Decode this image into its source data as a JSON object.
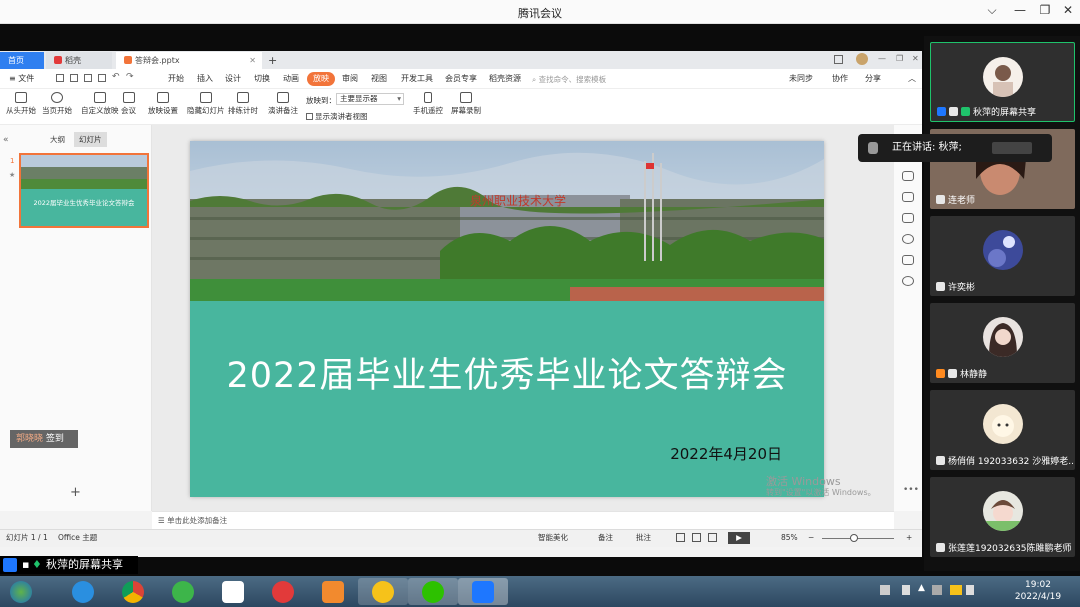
{
  "window": {
    "title": "腾讯会议",
    "controls": [
      "⌵",
      "—",
      "❐",
      "✕"
    ]
  },
  "wps": {
    "tabs": [
      {
        "label": "首页"
      },
      {
        "label": "稻壳"
      },
      {
        "label": "答辩会.pptx"
      }
    ],
    "tab_add": "+",
    "file_menu": "≡ 文件",
    "menus": [
      "开始",
      "插入",
      "设计",
      "切换",
      "动画",
      "放映",
      "审阅",
      "视图",
      "开发工具",
      "会员专享",
      "稻壳资源"
    ],
    "active_menu": "放映",
    "search_placeholder": "查找命令、搜索模板",
    "menu_right": [
      "未同步",
      "协作",
      "分享"
    ],
    "ribbon": {
      "buttons": [
        "从头开始",
        "当页开始",
        "自定义放映",
        "会议",
        "放映设置",
        "隐藏幻灯片",
        "排练计时",
        "演讲备注",
        "手机遥控",
        "屏幕录制"
      ],
      "show_on_label": "放映到：",
      "show_on_value": "主要显示器",
      "presenter_view": "显示演讲者视图"
    },
    "pane_tabs": [
      "大纲",
      "幻灯片"
    ],
    "thumb_number": "1",
    "thumb_title": "2022届毕业生优秀毕业论文答辩会",
    "slide": {
      "sign_text": "泉州职业技术大学",
      "title": "2022届毕业生优秀毕业论文答辩会",
      "date": "2022年4月20日"
    },
    "notes_placeholder": "单击此处添加备注",
    "add_slide": "+",
    "status": {
      "slide_count": "幻灯片 1 / 1",
      "theme": "Office 主题",
      "smart": "智能美化",
      "notes": "备注",
      "comments": "批注",
      "zoom": "85%",
      "minus": "−",
      "plus": "+"
    },
    "activate_title": "激活 Windows",
    "activate_sub": "转到\"设置\"以激活 Windows。"
  },
  "signin": {
    "name": "郭晓晓",
    "action": "签到"
  },
  "share_badge": "秋萍的屏幕共享",
  "speaking": "正在讲话: 秋萍;",
  "participants": [
    {
      "name": "秋萍的屏幕共享",
      "color": "#f6f0ea"
    },
    {
      "name": "连老师",
      "color": "#c98a70"
    },
    {
      "name": "许奕彬",
      "color": "#3d4a9a"
    },
    {
      "name": "林静静",
      "color": "#e9e3e0"
    },
    {
      "name": "杨俏俏 192033632 沙雅婷老...",
      "color": "#f3e7d2"
    },
    {
      "name": "张莲莲192032635陈雎鹏老师",
      "color": "#e7e7e0"
    }
  ],
  "clock": {
    "time": "19:02",
    "date": "2022/4/19"
  },
  "colors": {
    "accent": "#f2743a",
    "slide_bg": "#48b69e",
    "wps_blue": "#2f7ff0",
    "speaker_green": "#1fc26b"
  }
}
